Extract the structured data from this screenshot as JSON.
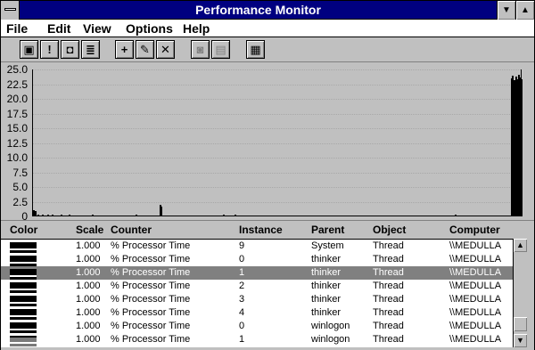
{
  "window": {
    "title": "Performance Monitor",
    "minimize_glyph": "▼",
    "maximize_glyph": "▲"
  },
  "menu": [
    "File",
    "Edit",
    "View",
    "Options",
    "Help"
  ],
  "toolbar": {
    "icons": [
      "chart-view-icon",
      "alert-view-icon",
      "log-view-icon",
      "report-view-icon",
      "add-counter-icon",
      "edit-counter-icon",
      "delete-counter-icon",
      "update-now-icon",
      "bookmark-icon",
      "options-icon"
    ],
    "add_glyph": "+",
    "edit_glyph": "✎",
    "delete_glyph": "✕"
  },
  "chart_data": {
    "type": "bar",
    "ylim": [
      0,
      25
    ],
    "y_ticks": [
      "25.0",
      "22.5",
      "20.0",
      "17.5",
      "15.0",
      "12.5",
      "10.0",
      "7.5",
      "5.0",
      "2.5",
      "0"
    ],
    "series": [
      {
        "values": [
          1.0,
          0.9,
          0.2,
          0.3,
          0.2,
          0.2,
          0.3,
          0.2,
          0.2,
          0.2,
          0.3,
          0.2,
          0.2,
          0.3,
          0.2,
          0.2,
          0.2,
          0.2,
          0.2,
          0.3,
          0.2,
          0.2,
          0.2,
          0.2,
          0.3,
          0.2,
          0.2,
          0.2,
          0.2,
          0.2,
          0.2,
          0.2,
          0.2,
          0.2,
          0.2,
          0.2,
          0.2,
          0.2,
          0.2,
          0.2,
          0.3,
          0.2,
          0.2,
          0.2,
          0.2,
          0.2,
          0.2,
          0.2,
          0.2,
          0.2,
          0.2,
          0.2,
          0.2,
          0.2,
          0.2,
          0.2,
          0.2,
          0.2,
          0.2,
          0.2,
          0.2,
          0.2,
          0.2,
          0.2,
          0.2,
          0.2,
          0.2,
          0.2,
          0.2,
          0.2,
          0.3,
          0.2,
          0.2,
          0.2,
          0.2,
          0.2,
          0.2,
          0.2,
          0.2,
          0.2,
          0.2,
          0.2,
          0.2,
          0.2,
          0.2,
          0.2,
          1.9,
          1.6,
          0.2,
          0.2,
          0.2,
          0.2,
          0.2,
          0.2,
          0.2,
          0.2,
          0.2,
          0.2,
          0.2,
          0.2,
          0.2,
          0.2,
          0.2,
          0.2,
          0.2,
          0.2,
          0.2,
          0.2,
          0.2,
          0.2,
          0.2,
          0.2,
          0.2,
          0.2,
          0.2,
          0.2,
          0.2,
          0.2,
          0.2,
          0.2,
          0.2,
          0.2,
          0.2,
          0.2,
          0.2,
          0.2,
          0.2,
          0.2,
          0.2,
          0.3,
          0.2,
          0.2,
          0.2,
          0.2,
          0.2,
          0.2,
          0.2,
          0.3,
          0.2,
          0.2,
          0.2,
          0.2,
          0.2,
          0.2,
          0.2,
          0.2,
          0.2,
          0.2,
          0.2,
          0.2,
          0.2,
          0.2,
          0.2,
          0.2,
          0.2,
          0.2,
          0.2,
          0.2,
          0.2,
          0.2,
          0.2,
          0.2,
          0.2,
          0.2,
          0.2,
          0.2,
          0.2,
          0.2,
          0.2,
          0.2,
          0.2,
          0.2,
          0.2,
          0.2,
          0.2,
          0.2,
          0.2,
          0.2,
          0.2,
          0.2,
          0.2,
          0.2,
          0.2,
          0.2,
          0.2,
          0.2,
          0.2,
          0.2,
          0.2,
          0.2,
          0.2,
          0.2,
          0.2,
          0.2,
          0.2,
          0.2,
          0.2,
          0.2,
          0.2,
          0.2,
          0.2,
          0.2,
          0.2,
          0.2,
          0.2,
          0.2,
          0.2,
          0.2,
          0.2,
          0.2,
          0.2,
          0.2,
          0.2,
          0.2,
          0.2,
          0.2,
          0.2,
          0.2,
          0.2,
          0.2,
          0.2,
          0.2,
          0.2,
          0.2,
          0.2,
          0.2,
          0.2,
          0.2,
          0.2,
          0.2,
          0.2,
          0.2,
          0.2,
          0.2,
          0.2,
          0.2,
          0.2,
          0.2,
          0.2,
          0.2,
          0.2,
          0.2,
          0.2,
          0.2,
          0.2,
          0.2,
          0.2,
          0.2,
          0.2,
          0.2,
          0.2,
          0.2,
          0.2,
          0.2,
          0.2,
          0.2,
          0.2,
          0.2,
          0.2,
          0.2,
          0.2,
          0.2,
          0.2,
          0.2,
          0.2,
          0.2,
          0.2,
          0.2,
          0.2,
          0.2,
          0.2,
          0.2,
          0.2,
          0.2,
          0.2,
          0.2,
          0.2,
          0.2,
          0.2,
          0.2,
          0.2,
          0.2,
          0.2,
          0.2,
          0.2,
          0.2,
          0.2,
          0.3,
          0.2,
          0.2,
          0.2,
          0.2,
          0.2,
          0.2,
          0.2,
          0.2,
          0.2,
          0.2,
          0.2,
          0.2,
          0.2,
          0.2,
          0.2,
          0.2,
          0.2,
          0.2,
          0.2,
          0.2,
          0.2,
          0.2,
          0.2,
          0.2,
          0.2,
          0.2,
          0.2,
          0.2,
          0.2,
          0.2,
          0.2,
          0.2,
          0.2,
          0.2,
          0.2,
          0.2,
          0.2,
          23.5,
          24.0,
          23.2,
          23.8,
          23.4,
          24.1,
          23.6,
          23.3
        ]
      }
    ]
  },
  "legend": {
    "headers": {
      "color": "Color",
      "scale": "Scale",
      "counter": "Counter",
      "instance": "Instance",
      "parent": "Parent",
      "object": "Object",
      "computer": "Computer"
    },
    "rows": [
      {
        "swatch": "black",
        "scale": "1.000",
        "counter": "% Processor Time",
        "instance": "9",
        "parent": "System",
        "object": "Thread",
        "computer": "\\\\MEDULLA",
        "selected": false
      },
      {
        "swatch": "black",
        "scale": "1.000",
        "counter": "% Processor Time",
        "instance": "0",
        "parent": "thinker",
        "object": "Thread",
        "computer": "\\\\MEDULLA",
        "selected": false
      },
      {
        "swatch": "black",
        "scale": "1.000",
        "counter": "% Processor Time",
        "instance": "1",
        "parent": "thinker",
        "object": "Thread",
        "computer": "\\\\MEDULLA",
        "selected": true
      },
      {
        "swatch": "black",
        "scale": "1.000",
        "counter": "% Processor Time",
        "instance": "2",
        "parent": "thinker",
        "object": "Thread",
        "computer": "\\\\MEDULLA",
        "selected": false
      },
      {
        "swatch": "black",
        "scale": "1.000",
        "counter": "% Processor Time",
        "instance": "3",
        "parent": "thinker",
        "object": "Thread",
        "computer": "\\\\MEDULLA",
        "selected": false
      },
      {
        "swatch": "black",
        "scale": "1.000",
        "counter": "% Processor Time",
        "instance": "4",
        "parent": "thinker",
        "object": "Thread",
        "computer": "\\\\MEDULLA",
        "selected": false
      },
      {
        "swatch": "black",
        "scale": "1.000",
        "counter": "% Processor Time",
        "instance": "0",
        "parent": "winlogon",
        "object": "Thread",
        "computer": "\\\\MEDULLA",
        "selected": false
      },
      {
        "swatch": "gray",
        "scale": "1.000",
        "counter": "% Processor Time",
        "instance": "1",
        "parent": "winlogon",
        "object": "Thread",
        "computer": "\\\\MEDULLA",
        "selected": false
      }
    ]
  },
  "scrollbar": {
    "up_glyph": "▲",
    "down_glyph": "▼"
  }
}
